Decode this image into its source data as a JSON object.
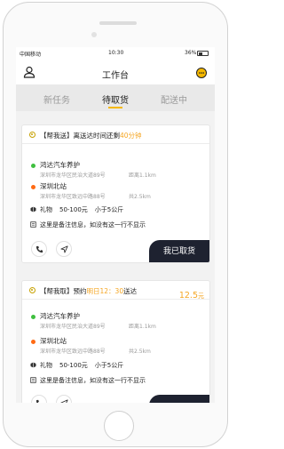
{
  "status_bar": {
    "carrier": "中国移动",
    "time": "10:30",
    "battery": "36%"
  },
  "nav": {
    "title": "工作台",
    "left_icon": "user-icon",
    "right_icon": "message-icon"
  },
  "tabs": [
    {
      "label": "新任务",
      "active": false
    },
    {
      "label": "待取货",
      "active": true
    },
    {
      "label": "配送中",
      "active": false
    }
  ],
  "colors": {
    "accent": "#f5a623",
    "dark_button": "#1e2230",
    "pickup_dot": "#3fbf3f",
    "delivery_dot": "#ff6a13"
  },
  "orders": [
    {
      "tag": "【帮我送】",
      "time_prefix": "离送达时间还剩",
      "time_value": "40分钟",
      "price": "",
      "price_unit": "",
      "pickup": {
        "name": "鸿达汽车养护",
        "address": "深圳市龙华区民治大道89号",
        "distance": "距离1.1km"
      },
      "delivery": {
        "name": "深圳北站",
        "address": "深圳市龙华区致远中路88号",
        "distance": "共2.5km"
      },
      "goods": {
        "type": "礼物",
        "value": "50-100元",
        "weight": "小于5公斤"
      },
      "remark": "这里是备注信息，如没有这一行不显示",
      "action_label": "我已取货"
    },
    {
      "tag": "【帮我取】",
      "time_prefix": "预约",
      "time_value": "明日12：30",
      "time_suffix": "送达",
      "price": "12.5",
      "price_unit": "元",
      "pickup": {
        "name": "鸿达汽车养护",
        "address": "深圳市龙华区民治大道89号",
        "distance": "距离1.1km"
      },
      "delivery": {
        "name": "深圳北站",
        "address": "深圳市龙华区致远中路88号",
        "distance": "共2.5km"
      },
      "goods": {
        "type": "礼物",
        "value": "50-100元",
        "weight": "小于5公斤"
      },
      "remark": "这里是备注信息，如没有这一行不显示"
    }
  ]
}
